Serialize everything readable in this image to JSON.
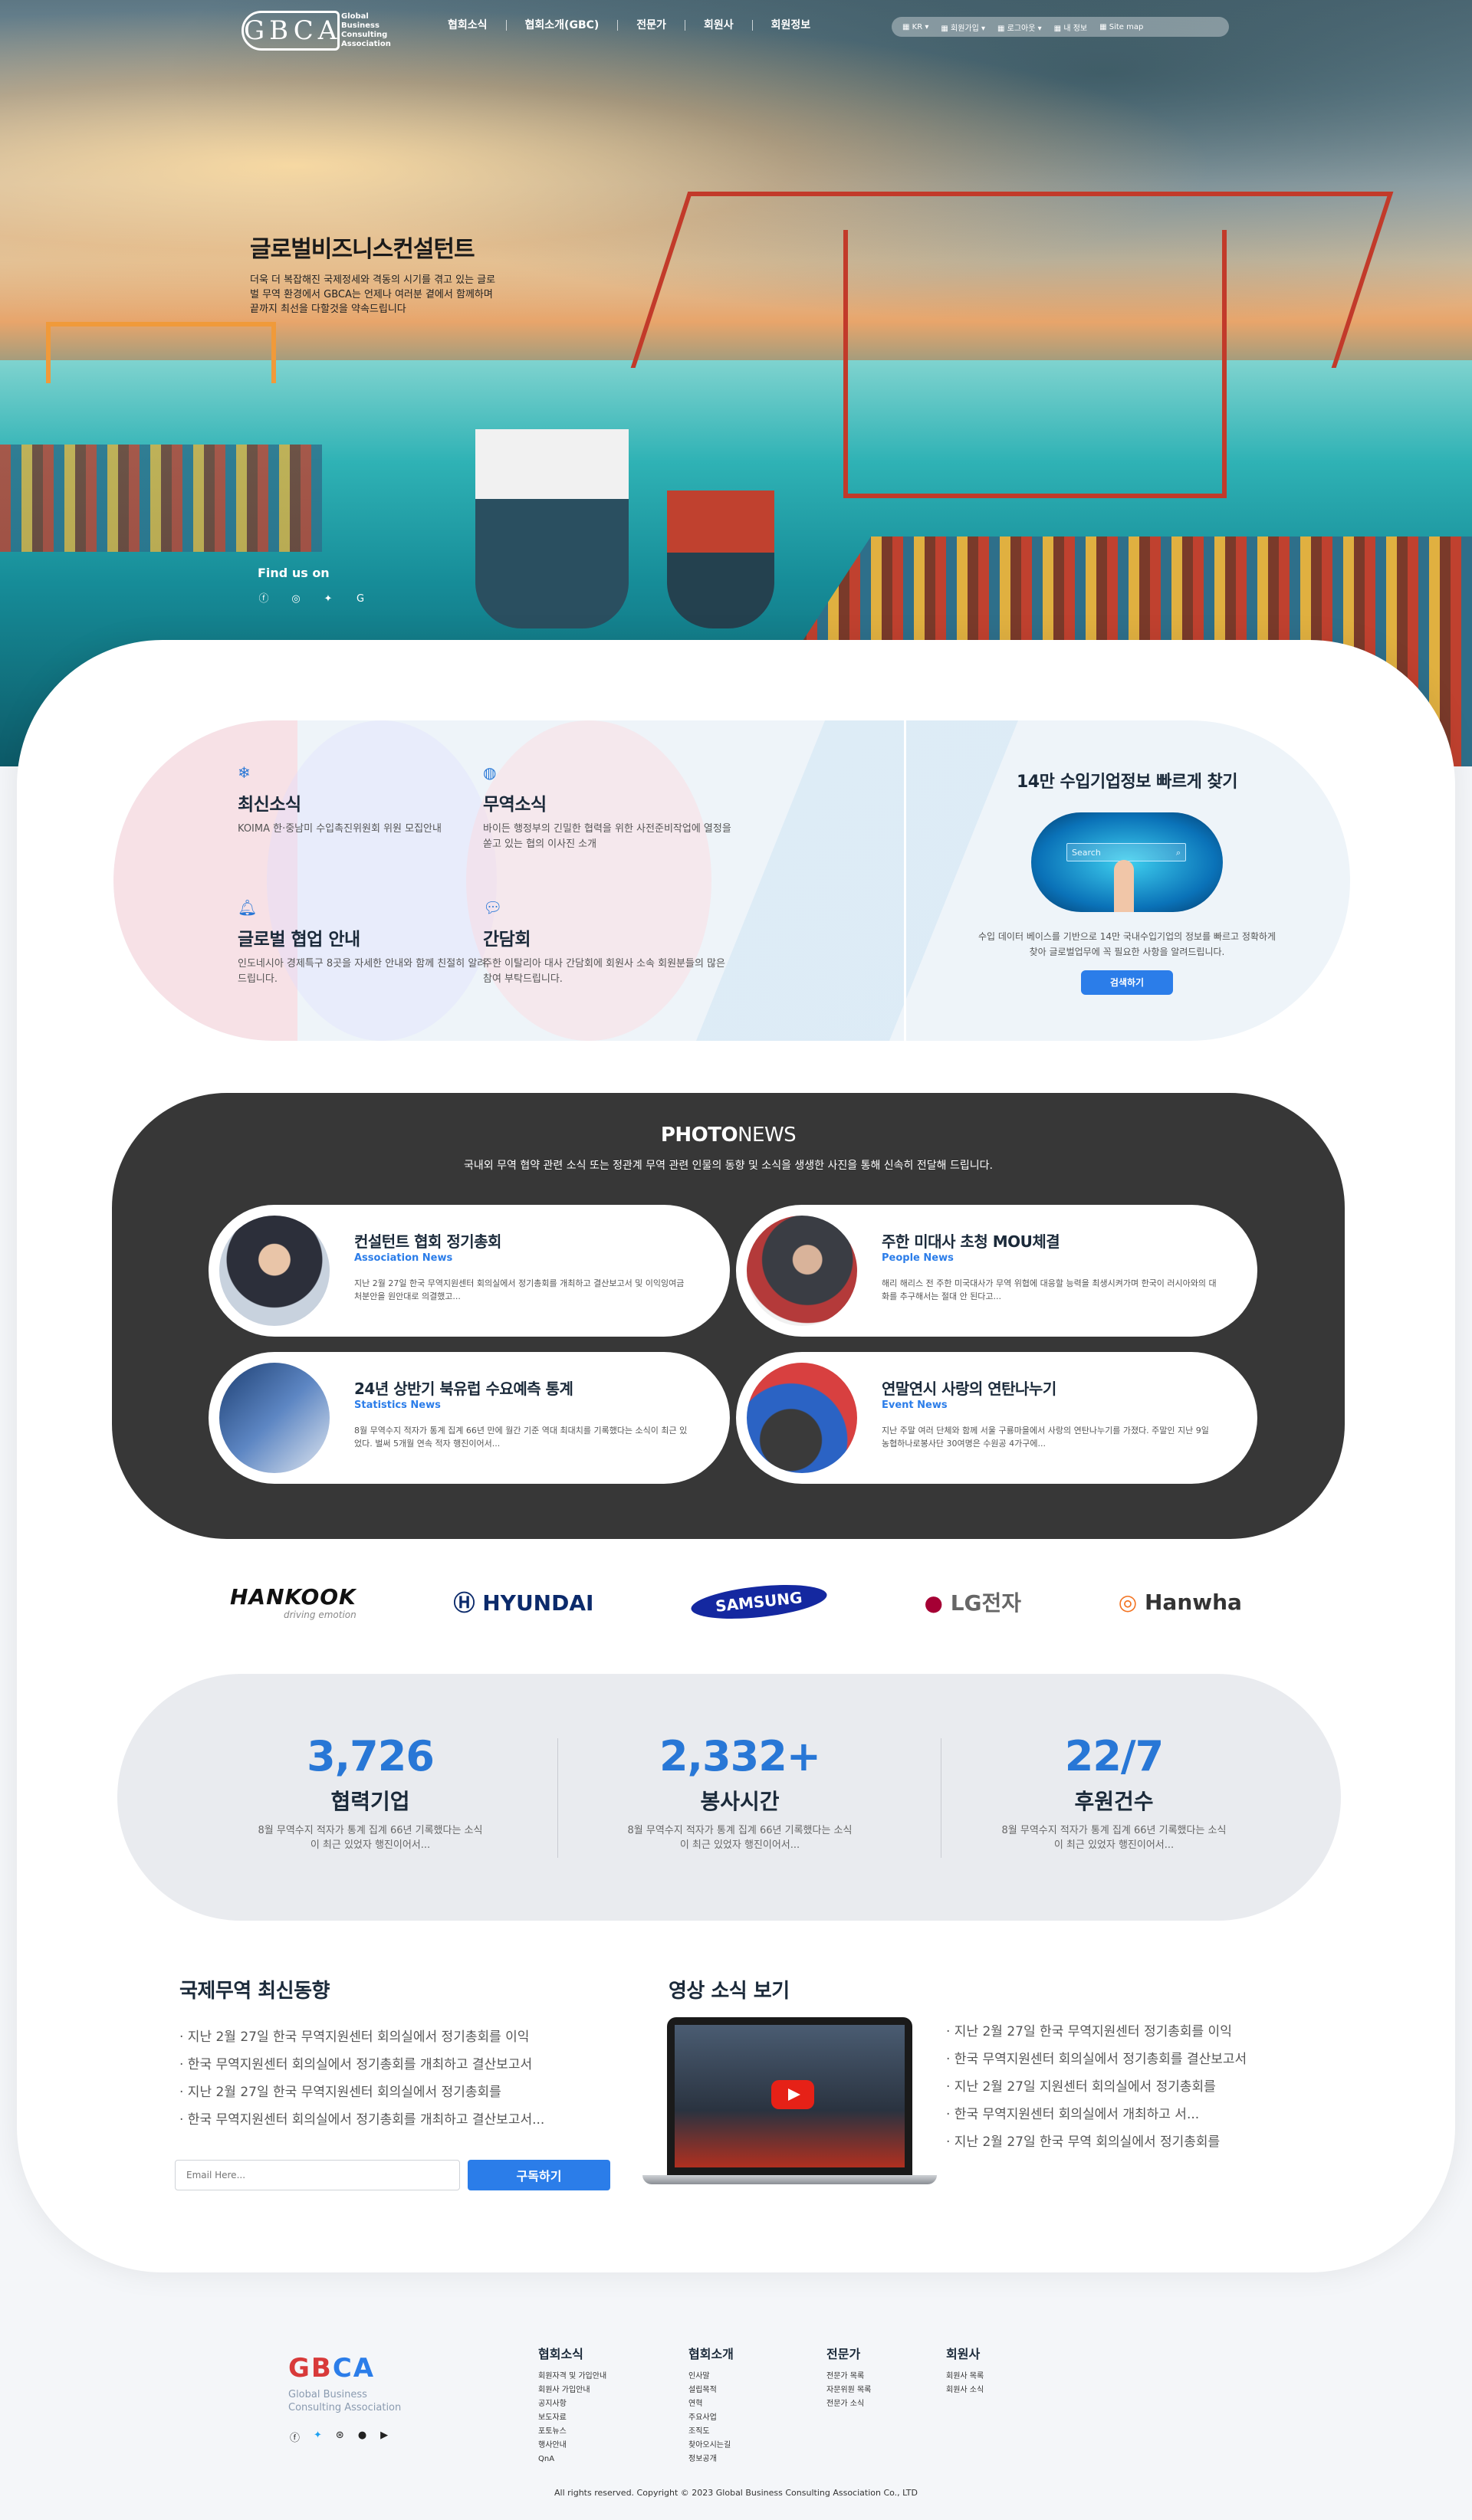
{
  "nav": {
    "logo_mark": "GBCA",
    "logo_text_1": "Global",
    "logo_text_2": "Business",
    "logo_text_3": "Consulting",
    "logo_text_4": "Association",
    "menu": [
      "협회소식",
      "협회소개(GBC)",
      "전문가",
      "회원사",
      "회원정보"
    ],
    "topbar": [
      "KR",
      "회원가입",
      "로그아웃",
      "내 정보",
      "Site map"
    ]
  },
  "hero": {
    "title": "글로벌비즈니스컨설턴트",
    "desc": "더욱 더 복잡해진 국제정세와 격동의 시기를 겪고 있는 글로벌 무역 환경에서 GBCA는 언제나 여러분 곁에서 함께하며 끝까지 최선을 다할것을 약속드립니다",
    "findus": "Find us on",
    "socials": [
      "facebook-icon",
      "instagram-icon",
      "twitter-icon",
      "google-icon"
    ]
  },
  "info": {
    "items": [
      {
        "title": "최신소식",
        "desc": "KOIMA 한·중남미 수입촉진위원회 위원 모집안내"
      },
      {
        "title": "무역소식",
        "desc": "바이든 행정부의 긴밀한 협력을 위한 사전준비작업에 열정을 쏟고 있는 협의 이사진 소개"
      },
      {
        "title": "글로벌 협업 안내",
        "desc": "인도네시아 경제특구 8곳을 자세한 안내와 함께 친절히 알려 드립니다."
      },
      {
        "title": "간담회",
        "desc": "주한 이탈리아 대사 간담회에 회원사 소속 회원분들의 많은 참여 부탁드립니다."
      }
    ],
    "search_title": "14만 수입기업정보 빠르게 찾기",
    "search_placeholder": "Search",
    "search_desc": "수입 데이터 베이스를 기반으로 14만 국내수입기업의 정보를 빠르고 정확하게 찾아 글로벌업무에 꼭 필요한 사항을 알려드립니다.",
    "search_button": "검색하기"
  },
  "photo": {
    "title_bold": "PHOTO",
    "title_light": "NEWS",
    "subtitle": "국내외 무역 협약 관련 소식 또는 정관계 무역 관련 인물의 동향 및 소식을 생생한 사진을 통해 신속히 전달해 드립니다.",
    "news": [
      {
        "title": "컨설턴트 협회 정기총회",
        "category": "Association News",
        "desc": "지난 2월 27일 한국 무역지원센터 회의실에서 정기총회를 개최하고 결산보고서 및 이익잉여금처분안을 원안대로 의결했고..."
      },
      {
        "title": "주한 미대사 초청 MOU체결",
        "category": "People News",
        "desc": "해리 해리스 전 주한 미국대사가 무역 위협에 대응할 능력을 최생시켜가며 한국이 러시아와의 대화를 추구해서는 절대 안 된다고..."
      },
      {
        "title": "24년 상반기 북유럽 수요예측 통계",
        "category": "Statistics News",
        "desc": "8월 무역수지 적자가 통계 집계 66년 만에 월간 기준 역대 최대치를 기록했다는 소식이 최근 있었다. 벌써 5개월 연속 적자 행진이어서..."
      },
      {
        "title": "연말연시 사랑의 연탄나누기",
        "category": "Event News",
        "desc": "지난 주말 여러 단체와 함께 서울 구룡마을에서 사랑의 연탄나누기를 가졌다. 주말인 지난 9일 농협하나로봉사단 30여명은 수원공 4가구에..."
      }
    ]
  },
  "brands": [
    "HANKOOK",
    "HYUNDAI",
    "SAMSUNG",
    "LG전자",
    "Hanwha"
  ],
  "brand_sub": "driving emotion",
  "stats": [
    {
      "num": "3,726",
      "label": "협력기업",
      "desc": "8월 무역수지 적자가 통계 집계 66년 기록했다는 소식이 최근 있었자 행진이어서..."
    },
    {
      "num": "2,332+",
      "label": "봉사시간",
      "desc": "8월 무역수지 적자가 통계 집계 66년 기록했다는 소식이 최근 있었자 행진이어서..."
    },
    {
      "num": "22/7",
      "label": "후원건수",
      "desc": "8월 무역수지 적자가 통계 집계 66년 기록했다는 소식이 최근 있었자 행진이어서..."
    }
  ],
  "trade": {
    "title": "국제무역 최신동향",
    "items": [
      "· 지난 2월 27일 한국 무역지원센터 회의실에서 정기총회를 이익",
      "· 한국 무역지원센터 회의실에서 정기총회를 개최하고 결산보고서",
      "· 지난 2월 27일 한국 무역지원센터 회의실에서 정기총회를",
      "· 한국 무역지원센터 회의실에서 정기총회를 개최하고 결산보고서..."
    ],
    "email_placeholder": "Email Here...",
    "subscribe": "구독하기"
  },
  "video": {
    "title": "영상 소식 보기",
    "items": [
      "· 지난 2월 27일 한국 무역지원센터  정기총회를 이익",
      "· 한국 무역지원센터 회의실에서 정기총회를  결산보고서",
      "· 지난 2월 27일  지원센터 회의실에서 정기총회를",
      "· 한국 무역지원센터 회의실에서  개최하고 서...",
      "· 지난 2월 27일 한국 무역 회의실에서 정기총회를"
    ]
  },
  "footer": {
    "logo_text_1": "Global Business",
    "logo_text_2": "Consulting Association",
    "cols": [
      {
        "title": "협회소식",
        "items": [
          "회원자격 및 가입안내",
          "회원사 가입안내",
          "공지사항",
          "보도자료",
          "포토뉴스",
          "행사안내",
          "QnA"
        ]
      },
      {
        "title": "협회소개",
        "items": [
          "인사말",
          "설립목적",
          "연혁",
          "주요사업",
          "조직도",
          "찾아오시는길",
          "정보공개"
        ]
      },
      {
        "title": "전문가",
        "items": [
          "전문가 목록",
          "자문위원 목록",
          "전문가 소식"
        ]
      },
      {
        "title": "회원사",
        "items": [
          "회원사 목록",
          "회원사 소식"
        ]
      }
    ],
    "socials": [
      "facebook-icon",
      "twitter-icon",
      "dribbble-icon",
      "github-icon",
      "youtube-icon"
    ],
    "copyright": "All rights reserved. Copyright © 2023 Global Business Consulting Association Co., LTD"
  }
}
